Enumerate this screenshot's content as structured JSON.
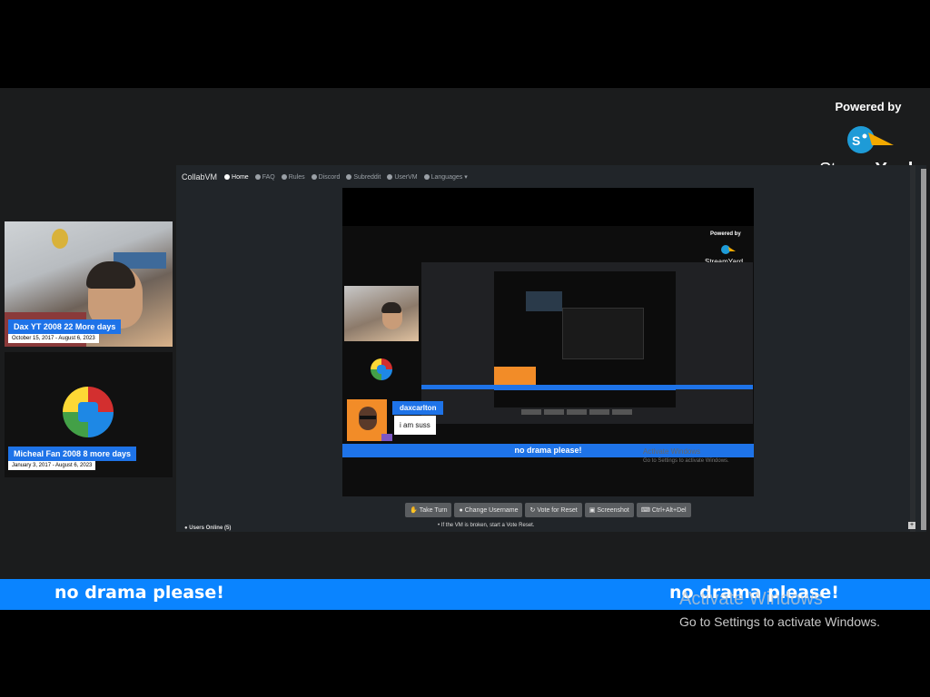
{
  "branding": {
    "powered_by": "Powered by",
    "logo_word_1": "Stream",
    "logo_word_2": "Yard"
  },
  "participants": [
    {
      "name": "Dax YT 2008 22 More days",
      "dates": "October 15, 2017 - August 6, 2023"
    },
    {
      "name": "Micheal Fan 2008 8 more days",
      "dates": "January 3, 2017 - August 6, 2023"
    }
  ],
  "share": {
    "brand": "CollabVM",
    "nav": [
      "Home",
      "FAQ",
      "Rules",
      "Discord",
      "Subreddit",
      "UserVM",
      "Languages"
    ],
    "buttons": [
      "Take Turn",
      "Change Username",
      "Vote for Reset",
      "Screenshot",
      "Ctrl+Alt+Del"
    ],
    "users_online": "Users Online (5)",
    "rule_text": "If the VM is broken, start a Vote Reset."
  },
  "vm": {
    "nested_powered_by": "Powered by",
    "nested_logo": "StreamYard",
    "chat_name": "daxcarlton",
    "chat_message": "i am suss",
    "banner": "no drama please!",
    "activate_title": "Activate Windows",
    "activate_sub": "Go to Settings to activate Windows."
  },
  "ticker": {
    "left": "no drama please!",
    "right": "no drama please!"
  },
  "windows_watermark": {
    "title": "Activate Windows",
    "subtitle": "Go to Settings to activate Windows."
  },
  "colors": {
    "accent": "#0a84ff",
    "name_tag": "#1e73e8",
    "background": "#000000"
  }
}
